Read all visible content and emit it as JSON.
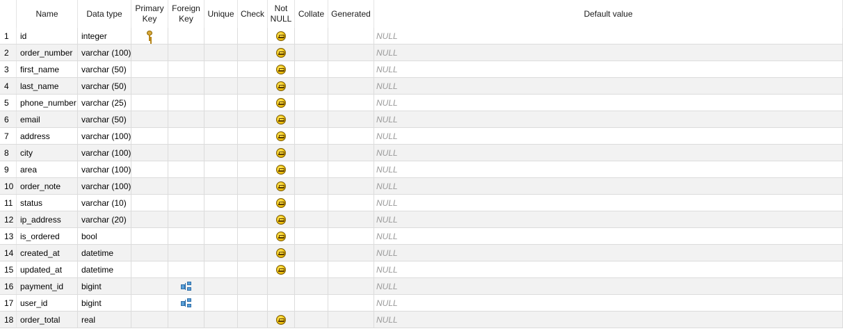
{
  "header": {
    "row_number": "",
    "name": "Name",
    "data_type": "Data type",
    "primary_key": "Primary\nKey",
    "foreign_key": "Foreign\nKey",
    "unique": "Unique",
    "check": "Check",
    "not_null": "Not\nNULL",
    "collate": "Collate",
    "generated": "Generated",
    "default_value": "Default value"
  },
  "rows": [
    {
      "num": "1",
      "name": "id",
      "type": "integer",
      "pk": true,
      "fk": false,
      "notnull": true,
      "default": "NULL"
    },
    {
      "num": "2",
      "name": "order_number",
      "type": "varchar (100)",
      "pk": false,
      "fk": false,
      "notnull": true,
      "default": "NULL"
    },
    {
      "num": "3",
      "name": "first_name",
      "type": "varchar (50)",
      "pk": false,
      "fk": false,
      "notnull": true,
      "default": "NULL"
    },
    {
      "num": "4",
      "name": "last_name",
      "type": "varchar (50)",
      "pk": false,
      "fk": false,
      "notnull": true,
      "default": "NULL"
    },
    {
      "num": "5",
      "name": "phone_number",
      "type": "varchar (25)",
      "pk": false,
      "fk": false,
      "notnull": true,
      "default": "NULL"
    },
    {
      "num": "6",
      "name": "email",
      "type": "varchar (50)",
      "pk": false,
      "fk": false,
      "notnull": true,
      "default": "NULL"
    },
    {
      "num": "7",
      "name": "address",
      "type": "varchar (100)",
      "pk": false,
      "fk": false,
      "notnull": true,
      "default": "NULL"
    },
    {
      "num": "8",
      "name": "city",
      "type": "varchar (100)",
      "pk": false,
      "fk": false,
      "notnull": true,
      "default": "NULL"
    },
    {
      "num": "9",
      "name": "area",
      "type": "varchar (100)",
      "pk": false,
      "fk": false,
      "notnull": true,
      "default": "NULL"
    },
    {
      "num": "10",
      "name": "order_note",
      "type": "varchar (100)",
      "pk": false,
      "fk": false,
      "notnull": true,
      "default": "NULL"
    },
    {
      "num": "11",
      "name": "status",
      "type": "varchar (10)",
      "pk": false,
      "fk": false,
      "notnull": true,
      "default": "NULL"
    },
    {
      "num": "12",
      "name": "ip_address",
      "type": "varchar (20)",
      "pk": false,
      "fk": false,
      "notnull": true,
      "default": "NULL"
    },
    {
      "num": "13",
      "name": "is_ordered",
      "type": "bool",
      "pk": false,
      "fk": false,
      "notnull": true,
      "default": "NULL"
    },
    {
      "num": "14",
      "name": "created_at",
      "type": "datetime",
      "pk": false,
      "fk": false,
      "notnull": true,
      "default": "NULL"
    },
    {
      "num": "15",
      "name": "updated_at",
      "type": "datetime",
      "pk": false,
      "fk": false,
      "notnull": true,
      "default": "NULL"
    },
    {
      "num": "16",
      "name": "payment_id",
      "type": "bigint",
      "pk": false,
      "fk": true,
      "notnull": false,
      "default": "NULL"
    },
    {
      "num": "17",
      "name": "user_id",
      "type": "bigint",
      "pk": false,
      "fk": true,
      "notnull": false,
      "default": "NULL"
    },
    {
      "num": "18",
      "name": "order_total",
      "type": "real",
      "pk": false,
      "fk": false,
      "notnull": true,
      "default": "NULL"
    }
  ],
  "icons": {
    "primary_key": "key-icon",
    "foreign_key": "foreign-key-icon",
    "not_null": "not-null-icon"
  }
}
